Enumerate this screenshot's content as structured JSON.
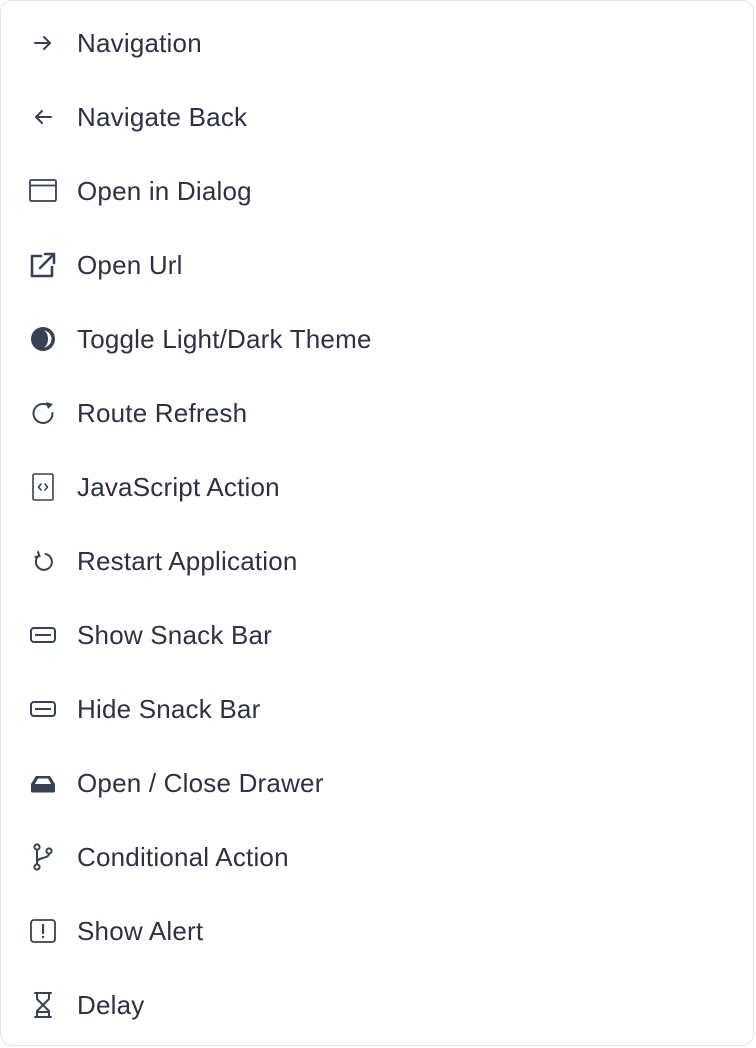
{
  "menu": {
    "items": [
      {
        "label": "Navigation",
        "icon": "arrow-right-icon"
      },
      {
        "label": "Navigate Back",
        "icon": "arrow-left-icon"
      },
      {
        "label": "Open in Dialog",
        "icon": "window-icon"
      },
      {
        "label": "Open Url",
        "icon": "external-link-icon"
      },
      {
        "label": "Toggle Light/Dark Theme",
        "icon": "contrast-icon"
      },
      {
        "label": "Route Refresh",
        "icon": "refresh-icon"
      },
      {
        "label": "JavaScript Action",
        "icon": "code-file-icon"
      },
      {
        "label": "Restart Application",
        "icon": "restart-icon"
      },
      {
        "label": "Show Snack Bar",
        "icon": "snackbar-icon"
      },
      {
        "label": "Hide Snack Bar",
        "icon": "snackbar-icon"
      },
      {
        "label": "Open / Close Drawer",
        "icon": "drawer-icon"
      },
      {
        "label": "Conditional Action",
        "icon": "branch-icon"
      },
      {
        "label": "Show Alert",
        "icon": "alert-icon"
      },
      {
        "label": "Delay",
        "icon": "hourglass-icon"
      }
    ]
  },
  "colors": {
    "text": "#2d3142",
    "icon": "#374151",
    "border": "#e2e4e9"
  }
}
